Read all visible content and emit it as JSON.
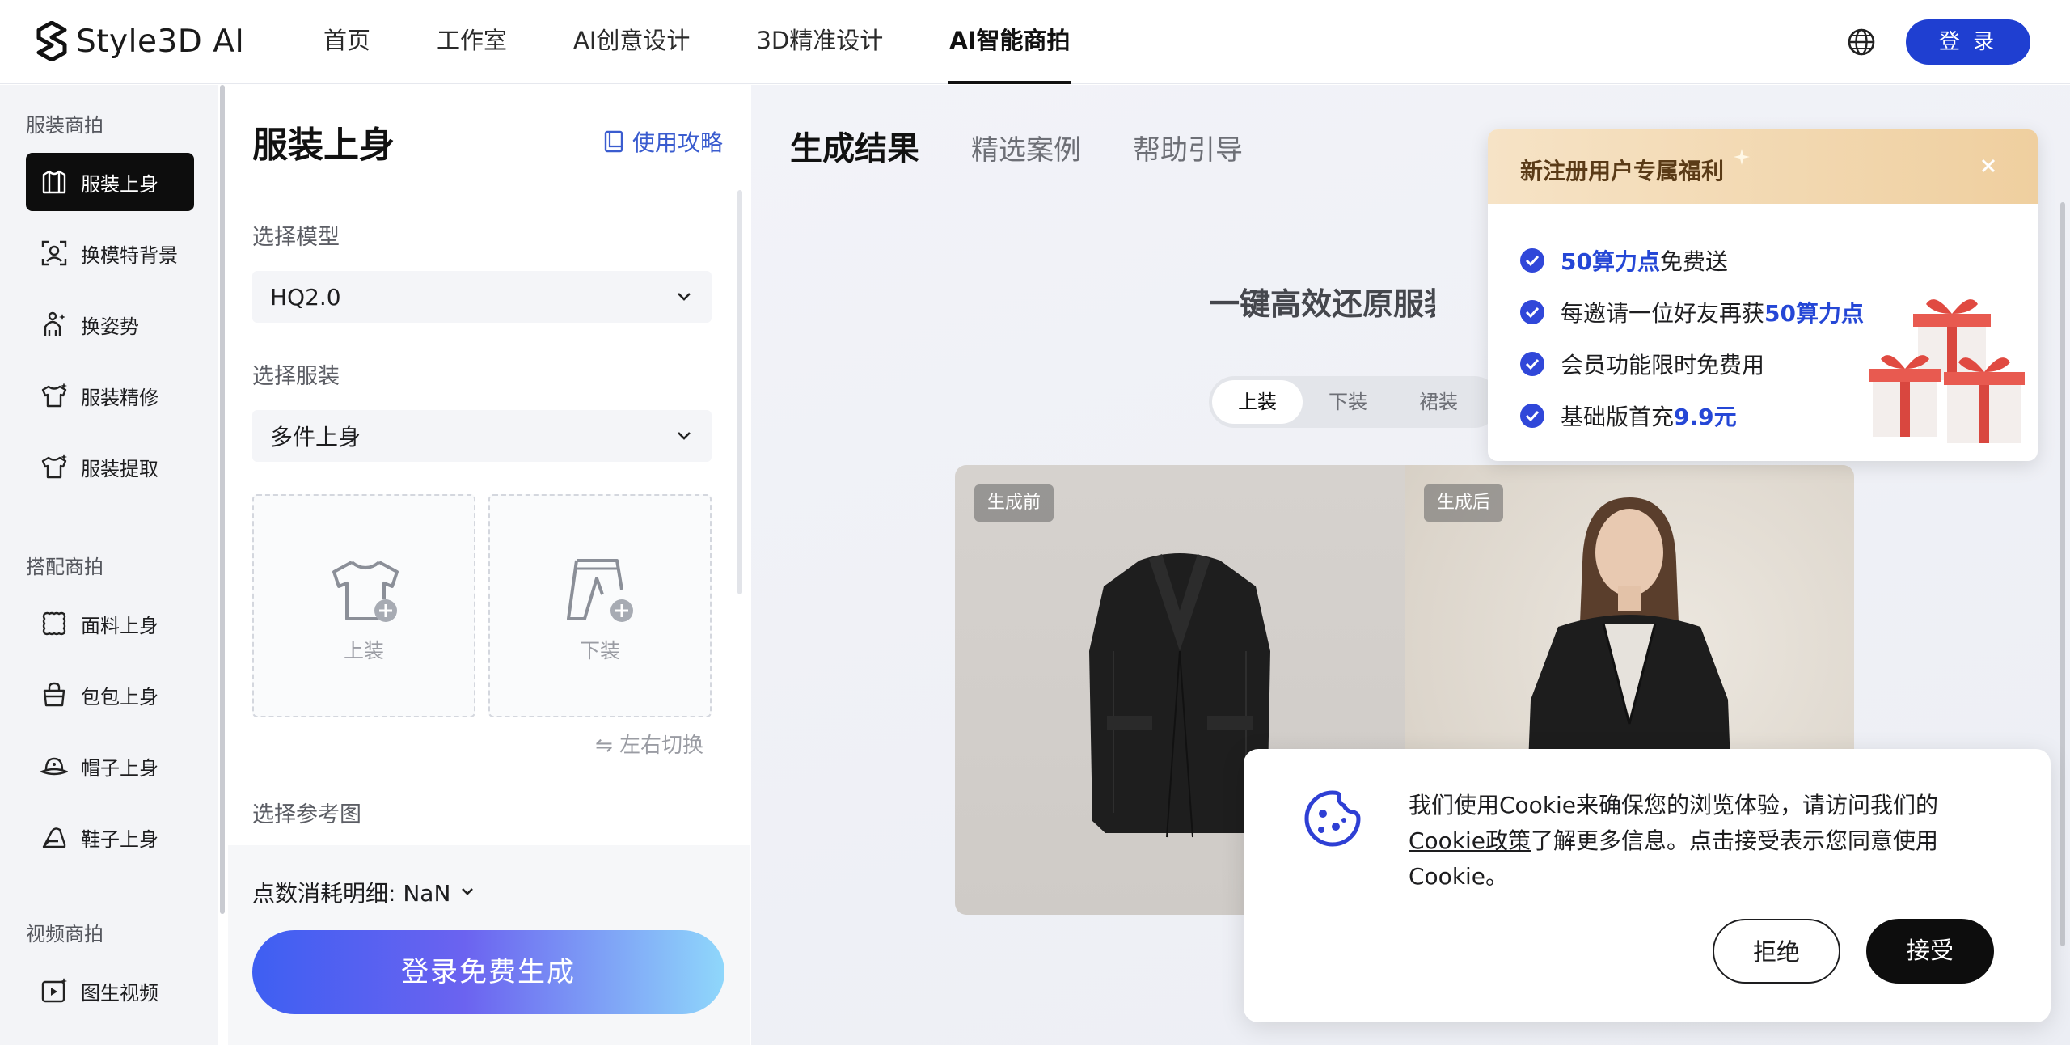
{
  "header": {
    "logo_text": "Style3D AI",
    "nav": [
      "首页",
      "工作室",
      "AI创意设计",
      "3D精准设计",
      "AI智能商拍"
    ],
    "active_nav": "AI智能商拍",
    "login_label": "登 录"
  },
  "sidebar": {
    "sections": [
      {
        "title": "服装商拍",
        "items": [
          "服装上身",
          "换模特背景",
          "换姿势",
          "服装精修",
          "服装提取"
        ]
      },
      {
        "title": "搭配商拍",
        "items": [
          "面料上身",
          "包包上身",
          "帽子上身",
          "鞋子上身"
        ]
      },
      {
        "title": "视频商拍",
        "items": [
          "图生视频"
        ]
      }
    ],
    "active_item": "服装上身"
  },
  "panel": {
    "title": "服装上身",
    "guide_label": "使用攻略",
    "model_label": "选择模型",
    "model_value": "HQ2.0",
    "garment_label": "选择服装",
    "garment_value": "多件上身",
    "upload_top": "上装",
    "upload_bottom": "下装",
    "swap_label": "⇋ 左右切换",
    "reference_label": "选择参考图",
    "cost_label": "点数消耗明细: NaN",
    "generate_label": "登录免费生成"
  },
  "main": {
    "tabs": [
      "生成结果",
      "精选案例",
      "帮助引导"
    ],
    "active_tab": "生成结果",
    "headline": "一键高效还原服装逼",
    "segments": [
      "上装",
      "下装",
      "裙装"
    ],
    "active_segment": "上装",
    "before_tag": "生成前",
    "after_tag": "生成后"
  },
  "promo": {
    "title": "新注册用户专属福利",
    "rows": [
      {
        "pre": "",
        "hl": "50算力点",
        "post": "免费送"
      },
      {
        "pre": "每邀请一位好友再获",
        "hl": "50算力点",
        "post": ""
      },
      {
        "pre": "会员功能限时免费用",
        "hl": "",
        "post": ""
      },
      {
        "pre": "基础版首充",
        "hl": "9.9元",
        "post": ""
      }
    ]
  },
  "cookie": {
    "text_1": "我们使用Cookie来确保您的浏览体验，请访问我们的",
    "link": "Cookie政策",
    "text_2": "了解更多信息。点击接受表示您同意使用Cookie。",
    "reject_label": "拒绝",
    "accept_label": "接受"
  },
  "colors": {
    "accent": "#1f3fd1",
    "highlight": "#2547d6",
    "promo_header": "#f1d6ac"
  }
}
